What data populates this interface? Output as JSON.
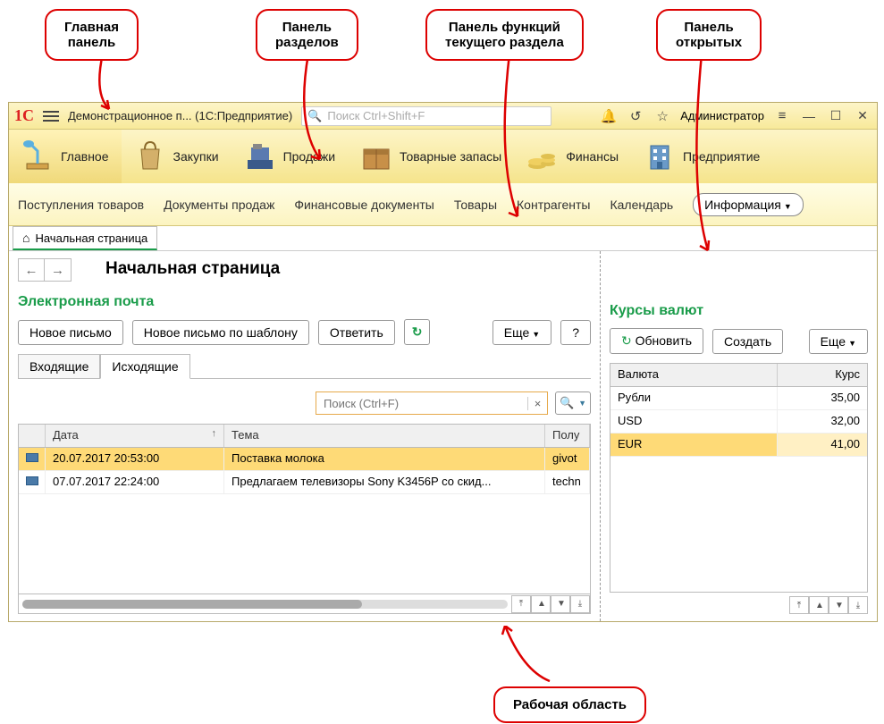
{
  "callouts": {
    "main_panel": "Главная\nпанель",
    "sections_panel": "Панель\nразделов",
    "functions_panel": "Панель функций\nтекущего раздела",
    "open_panel": "Панель\nоткрытых",
    "work_area": "Рабочая область"
  },
  "titlebar": {
    "title": "Демонстрационное п... (1С:Предприятие)",
    "search_placeholder": "Поиск Ctrl+Shift+F",
    "user": "Администратор"
  },
  "sections": [
    {
      "id": "home",
      "label": "Главное",
      "active": true
    },
    {
      "id": "purchases",
      "label": "Закупки"
    },
    {
      "id": "sales",
      "label": "Продажи"
    },
    {
      "id": "stock",
      "label": "Товарные запасы"
    },
    {
      "id": "finance",
      "label": "Финансы"
    },
    {
      "id": "company",
      "label": "Предприятие"
    }
  ],
  "functions": {
    "items": [
      "Поступления товаров",
      "Документы продаж",
      "Финансовые документы",
      "Товары",
      "Контрагенты",
      "Календарь"
    ],
    "button": "Информация"
  },
  "open_tab": "Начальная страница",
  "page": {
    "title": "Начальная страница"
  },
  "email": {
    "title": "Электронная почта",
    "buttons": {
      "new": "Новое письмо",
      "new_tpl": "Новое письмо по шаблону",
      "reply": "Ответить",
      "more": "Еще",
      "help": "?"
    },
    "tabs": {
      "inbox": "Входящие",
      "outbox": "Исходящие"
    },
    "search_placeholder": "Поиск (Ctrl+F)",
    "headers": {
      "date": "Дата",
      "subject": "Тема",
      "recipient": "Полу"
    },
    "rows": [
      {
        "date": "20.07.2017 20:53:00",
        "subject": "Поставка молока",
        "recipient": "givot",
        "selected": true
      },
      {
        "date": "07.07.2017 22:24:00",
        "subject": "Предлагаем телевизоры Sony K3456P со скид...",
        "recipient": "techn"
      }
    ]
  },
  "rates": {
    "title": "Курсы валют",
    "buttons": {
      "refresh": "Обновить",
      "create": "Создать",
      "more": "Еще"
    },
    "headers": {
      "currency": "Валюта",
      "rate": "Курс"
    },
    "rows": [
      {
        "currency": "Рубли",
        "rate": "35,00"
      },
      {
        "currency": "USD",
        "rate": "32,00"
      },
      {
        "currency": "EUR",
        "rate": "41,00",
        "selected": true
      }
    ]
  }
}
